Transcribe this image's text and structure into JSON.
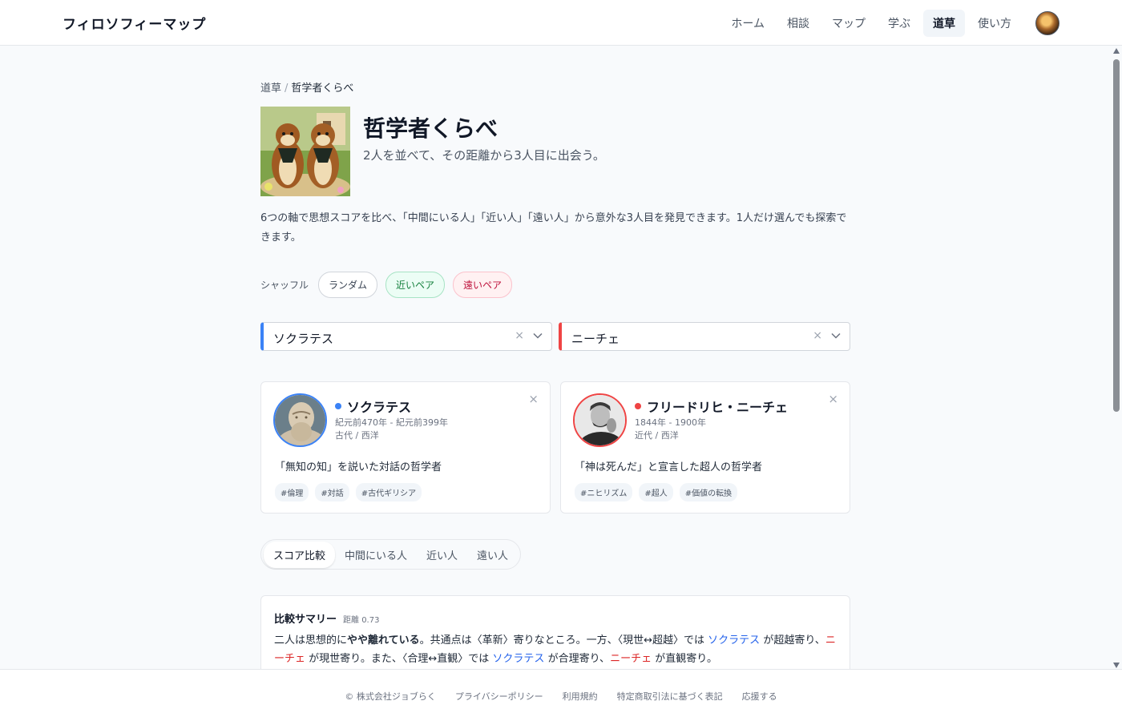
{
  "header": {
    "brand": "フィロソフィーマップ",
    "nav": [
      {
        "label": "ホーム"
      },
      {
        "label": "相談"
      },
      {
        "label": "マップ"
      },
      {
        "label": "学ぶ"
      },
      {
        "label": "道草",
        "active": true
      },
      {
        "label": "使い方"
      }
    ]
  },
  "breadcrumb": {
    "parent": "道草",
    "separator": "/",
    "current": "哲学者くらべ"
  },
  "page": {
    "title": "哲学者くらべ",
    "subtitle": "2人を並べて、その距離から3人目に出会う。",
    "description": "6つの軸で思想スコアを比べ、「中間にいる人」「近い人」「遠い人」から意外な3人目を発見できます。1人だけ選んでも探索できます。"
  },
  "shuffle": {
    "label": "シャッフル",
    "random": "ランダム",
    "near_pair": "近いペア",
    "far_pair": "遠いペア"
  },
  "selectors": {
    "left": {
      "value": "ソクラテス",
      "clear": "×"
    },
    "right": {
      "value": "ニーチェ",
      "clear": "×"
    }
  },
  "cards": {
    "left": {
      "name": "ソクラテス",
      "years": "紀元前470年 - 紀元前399年",
      "era": "古代 / 西洋",
      "quote": "「無知の知」を説いた対話の哲学者",
      "tags": [
        "#倫理",
        "#対話",
        "#古代ギリシア"
      ],
      "close": "×"
    },
    "right": {
      "name": "フリードリヒ・ニーチェ",
      "years": "1844年 - 1900年",
      "era": "近代 / 西洋",
      "quote": "「神は死んだ」と宣言した超人の哲学者",
      "tags": [
        "#ニヒリズム",
        "#超人",
        "#価値の転換"
      ],
      "close": "×"
    }
  },
  "tabs": [
    {
      "label": "スコア比較",
      "active": true
    },
    {
      "label": "中間にいる人"
    },
    {
      "label": "近い人"
    },
    {
      "label": "遠い人"
    }
  ],
  "summary": {
    "title": "比較サマリー",
    "distance": "距離 0.73",
    "t1": "二人は思想的に",
    "t2": "やや離れている",
    "t3": "。共通点は〈革新〉寄りなところ。一方、〈現世↔超越〉では ",
    "n1": "ソクラテス",
    "t4": " が超越寄り、",
    "n2": "ニーチェ",
    "t5": " が現世寄り。また、〈合理↔直観〉では ",
    "n3": "ソクラテス",
    "t6": " が合理寄り、",
    "n4": "ニーチェ",
    "t7": " が直観寄り。"
  },
  "footer": [
    {
      "label": "© 株式会社ジョブらく"
    },
    {
      "label": "プライバシーポリシー"
    },
    {
      "label": "利用規約"
    },
    {
      "label": "特定商取引法に基づく表記"
    },
    {
      "label": "応援する"
    }
  ],
  "colors": {
    "left_accent": "#3b82f6",
    "right_accent": "#ef4444",
    "near": "#15803d",
    "far": "#be123c"
  }
}
